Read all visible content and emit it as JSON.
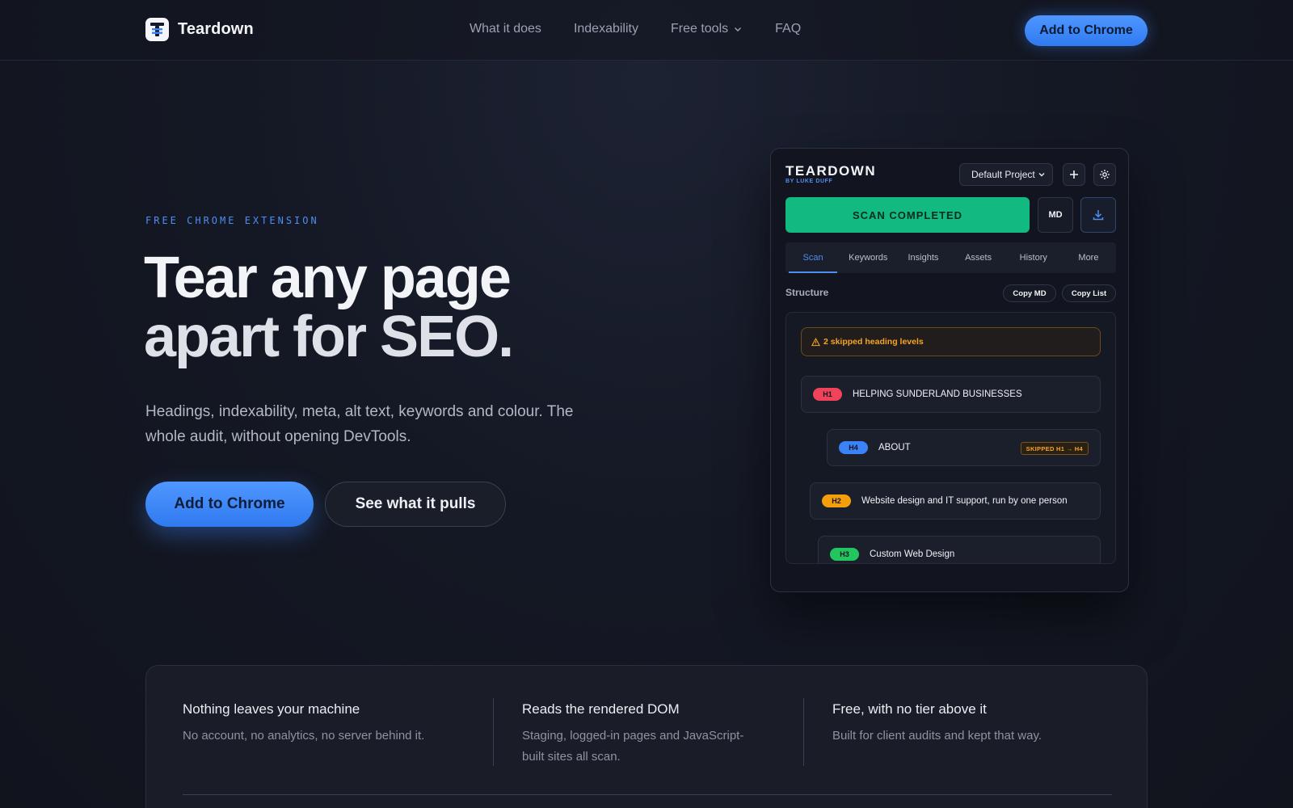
{
  "nav": {
    "brand": "Teardown",
    "links": [
      "What it does",
      "Indexability",
      "Free tools",
      "FAQ"
    ],
    "cta": "Add to Chrome"
  },
  "hero": {
    "eyebrow": "FREE CHROME EXTENSION",
    "title_line1": "Tear any page",
    "title_line2": "apart for SEO.",
    "subtitle": "Headings, indexability, meta, alt text, keywords and colour. The whole audit, without opening DevTools.",
    "primary_cta": "Add to Chrome",
    "secondary_cta": "See what it pulls"
  },
  "panel": {
    "brand": "TEARDOWN",
    "byline": "BY LUKE DUFF",
    "project": "Default Project",
    "scan_status": "SCAN COMPLETED",
    "md_label": "MD",
    "tabs": [
      "Scan",
      "Keywords",
      "Insights",
      "Assets",
      "History",
      "More"
    ],
    "active_tab": "Scan",
    "section_title": "Structure",
    "copy_md": "Copy MD",
    "copy_list": "Copy List",
    "warning": "2 skipped heading levels",
    "headings": [
      {
        "level": "H1",
        "text": "HELPING SUNDERLAND BUSINESSES",
        "color": "#f0435a"
      },
      {
        "level": "H4",
        "text": "ABOUT",
        "color": "#3b82f6",
        "flag": "SKIPPED H1 → H4"
      },
      {
        "level": "H2",
        "text": "Website design and IT support, run by one person",
        "color": "#f59e0b"
      },
      {
        "level": "H3",
        "text": "Custom Web Design",
        "color": "#22c55e"
      }
    ]
  },
  "features": [
    {
      "title": "Nothing leaves your machine",
      "desc": "No account, no analytics, no server behind it."
    },
    {
      "title": "Reads the rendered DOM",
      "desc": "Staging, logged-in pages and JavaScript-built sites all scan."
    },
    {
      "title": "Free, with no tier above it",
      "desc": "Built for client audits and kept that way."
    }
  ],
  "colors": {
    "accent": "#3b82f6",
    "success": "#12b981",
    "warning": "#f5a524",
    "background": "#141824"
  }
}
